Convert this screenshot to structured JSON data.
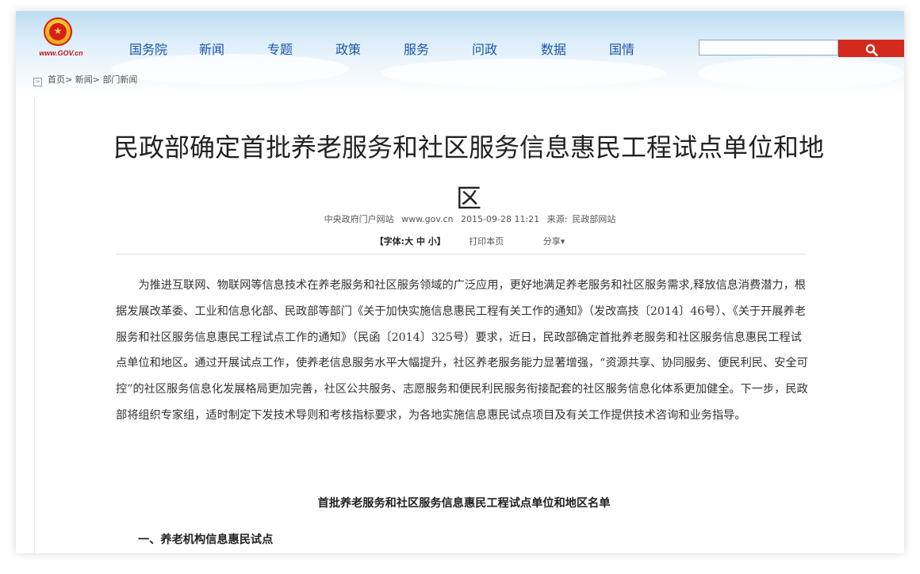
{
  "header": {
    "logo_text": "www.GOV.cn",
    "nav": [
      "国务院",
      "新闻",
      "专题",
      "政策",
      "服务",
      "问政",
      "数据",
      "国情"
    ],
    "search": {
      "placeholder": "",
      "button_icon": "search-icon"
    }
  },
  "breadcrumb": {
    "home": "首页",
    "news": "新闻",
    "dept": "部门新闻"
  },
  "article": {
    "title": "民政部确定首批养老服务和社区服务信息惠民工程试点单位和地区",
    "meta": {
      "source_site": "中央政府门户网站",
      "domain": "www.gov.cn",
      "datetime": "2015-09-28 11:21",
      "source_label": "来源:",
      "source": "民政部网站"
    },
    "tools": {
      "font_prefix": "【字体:",
      "font_large": "大",
      "font_medium": "中",
      "font_small": "小",
      "font_suffix": "】",
      "print": "打印本页",
      "share": "分享▾"
    },
    "body": "为推进互联网、物联网等信息技术在养老服务和社区服务领域的广泛应用，更好地满足养老服务和社区服务需求,释放信息消费潜力，根据发展改革委、工业和信息化部、民政部等部门《关于加快实施信息惠民工程有关工作的通知》（发改高技〔2014〕46号）、《关于开展养老服务和社区服务信息惠民工程试点工作的通知》（民函〔2014〕325号）要求，近日，民政部确定首批养老服务和社区服务信息惠民工程试点单位和地区。通过开展试点工作，使养老信息服务水平大幅提升，社区养老服务能力显著增强，“资源共享、协同服务、便民利民、安全可控”的社区服务信息化发展格局更加完善，社区公共服务、志愿服务和便民利民服务衔接配套的社区服务信息化体系更加健全。下一步，民政部将组织专家组，适时制定下发技术导则和考核指标要求，为各地实施信息惠民试点项目及有关工作提供技术咨询和业务指导。",
    "list_title": "首批养老服务和社区服务信息惠民工程试点单位和地区名单",
    "section_1": "一、养老机构信息惠民试点"
  },
  "colors": {
    "nav_text": "#1a56a8",
    "search_button": "#d42a1e",
    "logo_red": "#c4161c",
    "title_text": "#222222"
  }
}
